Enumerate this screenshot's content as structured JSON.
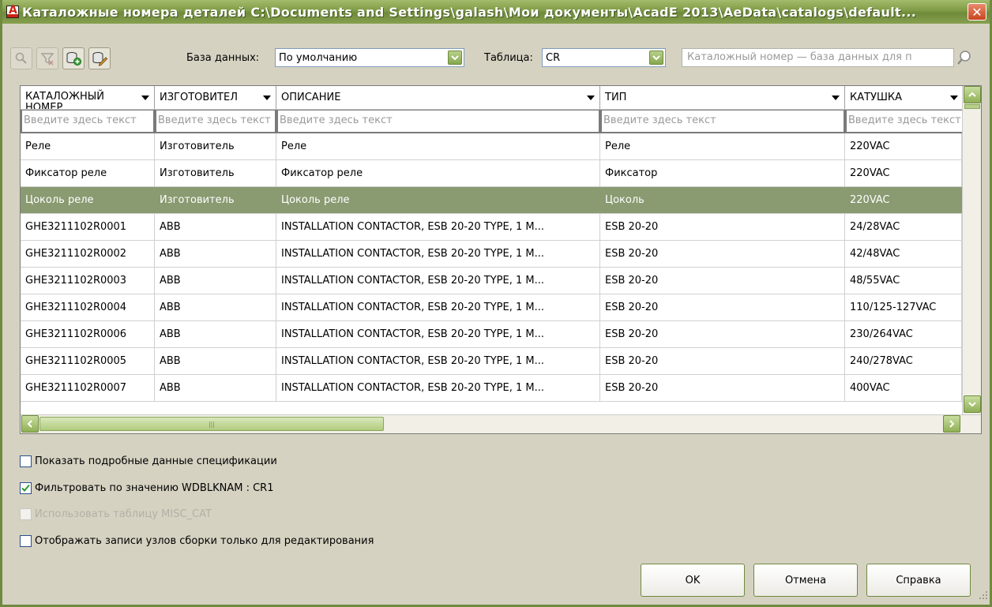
{
  "window": {
    "title": "Каталожные номера деталей C:\\Documents and Settings\\galash\\Мои документы\\AcadE 2013\\AeData\\catalogs\\default...",
    "close_label": "✕"
  },
  "toolbar": {
    "db_label": "База данных:",
    "db_value": "По умолчанию",
    "table_label": "Таблица:",
    "table_value": "CR",
    "search_placeholder": "Каталожный номер — база данных для п"
  },
  "grid": {
    "columns": [
      {
        "label": "КАТАЛОЖНЫЙ НОМЕР"
      },
      {
        "label": "ИЗГОТОВИТЕЛ"
      },
      {
        "label": "ОПИСАНИЕ"
      },
      {
        "label": "ТИП"
      },
      {
        "label": "КАТУШКА"
      }
    ],
    "filter_placeholder": "Введите здесь текст",
    "rows": [
      [
        "Реле",
        "Изготовитель",
        "Реле",
        "Реле",
        "220VAC"
      ],
      [
        "Фиксатор реле",
        "Изготовитель",
        "Фиксатор реле",
        "Фиксатор",
        "220VAC"
      ],
      [
        "Цоколь реле",
        "Изготовитель",
        "Цоколь реле",
        "Цоколь",
        "220VAC"
      ],
      [
        "GHE3211102R0001",
        "ABB",
        "INSTALLATION CONTACTOR, ESB 20-20 TYPE, 1 M...",
        "ESB 20-20",
        "24/28VAC"
      ],
      [
        "GHE3211102R0002",
        "ABB",
        "INSTALLATION CONTACTOR, ESB 20-20 TYPE, 1 M...",
        "ESB 20-20",
        "42/48VAC"
      ],
      [
        "GHE3211102R0003",
        "ABB",
        "INSTALLATION CONTACTOR, ESB 20-20 TYPE, 1 M...",
        "ESB 20-20",
        "48/55VAC"
      ],
      [
        "GHE3211102R0004",
        "ABB",
        "INSTALLATION CONTACTOR, ESB 20-20 TYPE, 1 M...",
        "ESB 20-20",
        "110/125-127VAC"
      ],
      [
        "GHE3211102R0006",
        "ABB",
        "INSTALLATION CONTACTOR, ESB 20-20 TYPE, 1 M...",
        "ESB 20-20",
        "230/264VAC"
      ],
      [
        "GHE3211102R0005",
        "ABB",
        "INSTALLATION CONTACTOR, ESB 20-20 TYPE, 1 M...",
        "ESB 20-20",
        "240/278VAC"
      ],
      [
        "GHE3211102R0007",
        "ABB",
        "INSTALLATION CONTACTOR, ESB 20-20 TYPE, 1 M...",
        "ESB 20-20",
        "400VAC"
      ]
    ],
    "selected_row": 2
  },
  "options": {
    "show_bom": {
      "label": "Показать подробные данные спецификации",
      "checked": false
    },
    "filter_wdblknam": {
      "label": "Фильтровать по значению WDBLKNAM : CR1",
      "checked": true
    },
    "use_misc_cat": {
      "label": "Использовать таблицу MISC_CAT",
      "checked": false,
      "disabled": true
    },
    "assembly_edit_only": {
      "label": "Отображать записи узлов сборки только для редактирования",
      "checked": false
    }
  },
  "buttons": {
    "ok": "OK",
    "cancel": "Отмена",
    "help": "Справка"
  },
  "colors": {
    "titlebar": "#7f9b46",
    "selection": "#8a9a71",
    "dialog_bg": "#d6d2c2",
    "accent": "#6f8a3f"
  }
}
